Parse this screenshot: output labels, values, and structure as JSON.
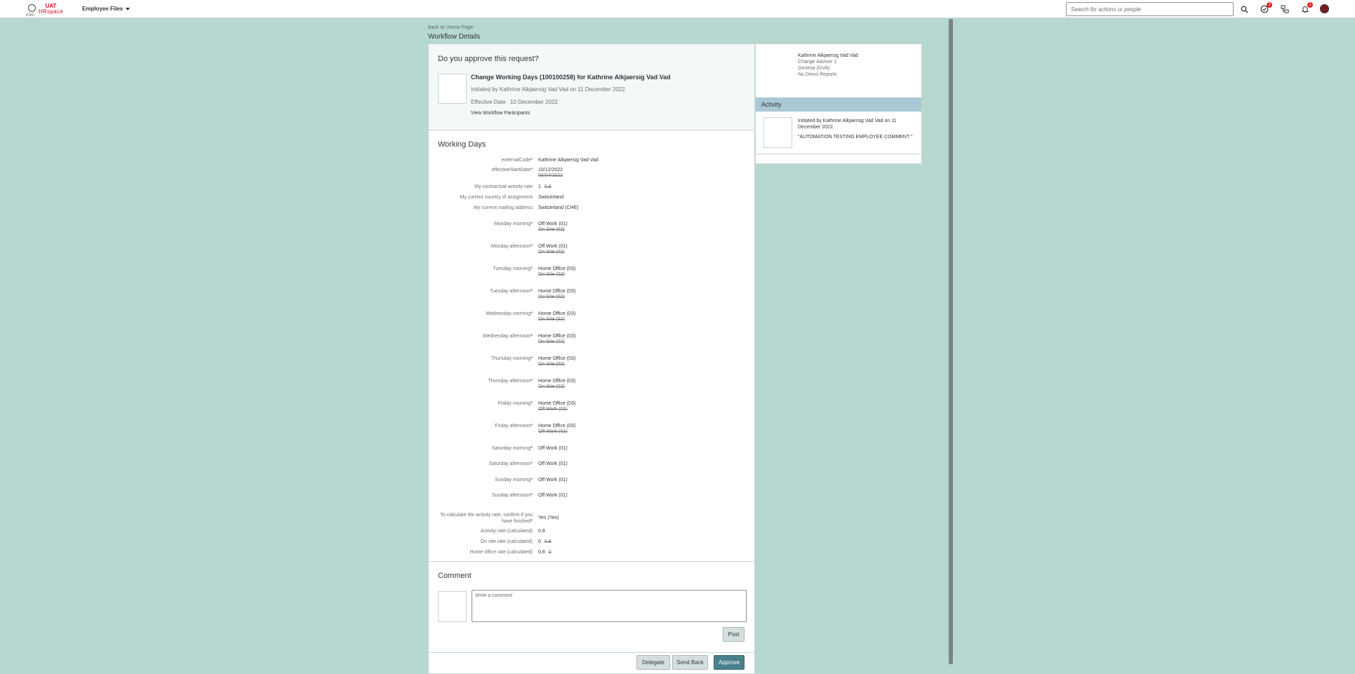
{
  "header": {
    "brand_top": "UAT",
    "brand_bottom": "HRspace",
    "seal_text": "ICRC",
    "menu_label": "Employee Files",
    "search_placeholder": "Search for actions or people",
    "icons": [
      "search-icon",
      "approvals-icon",
      "org-chart-icon",
      "notifications-icon"
    ],
    "approvals_badge": "2",
    "notifications_badge": "1"
  },
  "page": {
    "breadcrumb": "Back to: Home Page",
    "title": "Workflow Details"
  },
  "request": {
    "question": "Do you approve this request?",
    "title": "Change Working Days (100100258) for Kathrine Alkjaersig Vad Vad",
    "initiated": "Initiated by Kathrine Alkjaersig Vad Vad on 11 December 2022",
    "effective_label": "Effective Date",
    "effective_date": "10 December 2022",
    "participants_link": "View Workflow Participants"
  },
  "working_days": {
    "heading": "Working Days",
    "rows": [
      {
        "label": "externalCode",
        "required": "*",
        "value": "Kathrine Alkjaersig Vad Vad",
        "old": ""
      },
      {
        "label": "effectiveStartDate",
        "required": "*",
        "value": "10/12/2022",
        "old": "06/04/2022"
      },
      {
        "label": "My contractual activity rate",
        "required": "",
        "value": "1",
        "old": "0.8"
      },
      {
        "label": "My current country of assignment",
        "required": "",
        "value": "Switzerland",
        "old": ""
      },
      {
        "label": "My current mailing address",
        "required": "",
        "value": "Switzerland (CHE)",
        "old": ""
      },
      {
        "label": "Monday morning",
        "required": "*",
        "value": "Off Work (01)",
        "old": "On Site (02)"
      },
      {
        "label": "Monday afternoon",
        "required": "*",
        "value": "Off Work (01)",
        "old": "On Site (02)"
      },
      {
        "label": "Tuesday morning",
        "required": "*",
        "value": "Home Office (03)",
        "old": "On Site (02)"
      },
      {
        "label": "Tuesday afternoon",
        "required": "*",
        "value": "Home Office (03)",
        "old": "On Site (02)"
      },
      {
        "label": "Wednesday morning",
        "required": "*",
        "value": "Home Office (03)",
        "old": "On Site (02)"
      },
      {
        "label": "Wednesday afternoon",
        "required": "*",
        "value": "Home Office (03)",
        "old": "On Site (02)"
      },
      {
        "label": "Thursday morning",
        "required": "*",
        "value": "Home Office (03)",
        "old": "On Site (02)"
      },
      {
        "label": "Thursday afternoon",
        "required": "*",
        "value": "Home Office (03)",
        "old": "On Site (02)"
      },
      {
        "label": "Friday morning",
        "required": "*",
        "value": "Home Office (03)",
        "old": "Off Work (01)"
      },
      {
        "label": "Friday afternoon",
        "required": "*",
        "value": "Home Office (03)",
        "old": "Off Work (01)"
      },
      {
        "label": "Saturday morning",
        "required": "*",
        "value": "Off Work (01)",
        "old": ""
      },
      {
        "label": "Saturday afternoon",
        "required": "*",
        "value": "Off Work (01)",
        "old": ""
      },
      {
        "label": "Sunday morning",
        "required": "*",
        "value": "Off Work (01)",
        "old": ""
      },
      {
        "label": "Sunday afternoon",
        "required": "*",
        "value": "Off Work (01)",
        "old": ""
      },
      {
        "label": "To calculate the activity rate, confirm if you have finished",
        "required": "*",
        "value": "Yes (Yes)",
        "old": ""
      },
      {
        "label": "Activity rate (calculated)",
        "required": "",
        "value": "0.8",
        "old": ""
      },
      {
        "label": "On site rate (calculated)",
        "required": "",
        "value": "0",
        "old": "0.8"
      },
      {
        "label": "Home office rate (calculated)",
        "required": "",
        "value": "0.8",
        "old": "0"
      }
    ]
  },
  "comment": {
    "heading": "Comment",
    "placeholder": "Write a comment",
    "post_label": "Post"
  },
  "actions": {
    "delegate": "Delegate",
    "send_back": "Send Back",
    "approve": "Approve"
  },
  "person": {
    "name": "Kathrine Alkjaersig Vad Vad",
    "role": "Change Adviser 1",
    "location": "Geneva (GVA)",
    "reports": "No Direct Reports"
  },
  "activity": {
    "heading": "Activity",
    "entry": "Initiated by Kathrine Alkjaersig Vad Vad on 11 December 2022.",
    "comment": "\"AUTOMATION TESTING EMPLOYEE COMMENT \""
  }
}
